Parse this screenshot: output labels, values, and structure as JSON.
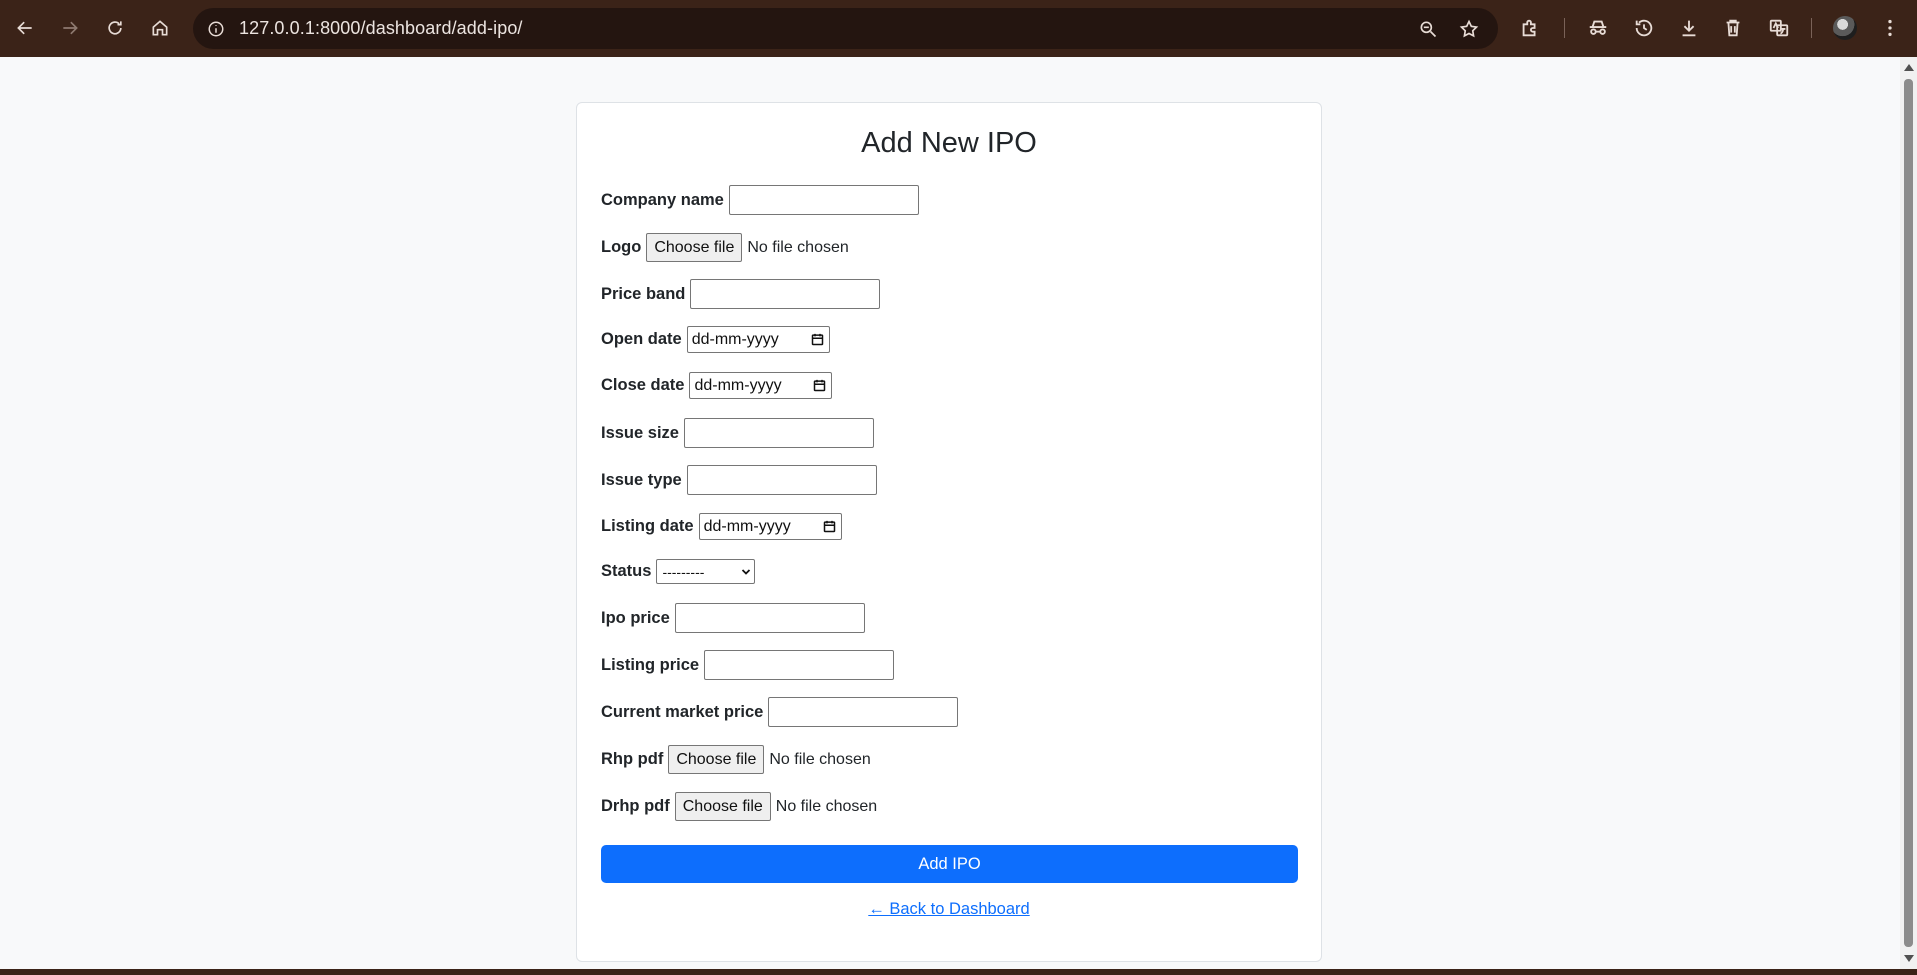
{
  "browser": {
    "url": "127.0.0.1:8000/dashboard/add-ipo/",
    "icons": {
      "back": "back-arrow-icon",
      "forward": "forward-arrow-icon",
      "reload": "reload-icon",
      "home": "home-icon",
      "site_info": "info-icon",
      "zoom": "zoom-icon",
      "bookmark": "star-icon",
      "extensions": "puzzle-icon",
      "incognito": "incognito-icon",
      "history": "history-icon",
      "downloads": "download-icon",
      "delete": "trash-icon",
      "translate": "translate-icon",
      "menu": "kebab-menu-icon"
    }
  },
  "form": {
    "title": "Add New IPO",
    "fields": {
      "company_name": {
        "label": "Company name",
        "value": ""
      },
      "logo": {
        "label": "Logo",
        "button": "Choose file",
        "status": "No file chosen"
      },
      "price_band": {
        "label": "Price band",
        "value": ""
      },
      "open_date": {
        "label": "Open date",
        "placeholder": "dd-mm-yyyy"
      },
      "close_date": {
        "label": "Close date",
        "placeholder": "dd-mm-yyyy"
      },
      "issue_size": {
        "label": "Issue size",
        "value": ""
      },
      "issue_type": {
        "label": "Issue type",
        "value": ""
      },
      "listing_date": {
        "label": "Listing date",
        "placeholder": "dd-mm-yyyy"
      },
      "status": {
        "label": "Status",
        "selected": "---------"
      },
      "ipo_price": {
        "label": "Ipo price",
        "value": ""
      },
      "listing_price": {
        "label": "Listing price",
        "value": ""
      },
      "current_market_price": {
        "label": "Current market price",
        "value": ""
      },
      "rhp_pdf": {
        "label": "Rhp pdf",
        "button": "Choose file",
        "status": "No file chosen"
      },
      "drhp_pdf": {
        "label": "Drhp pdf",
        "button": "Choose file",
        "status": "No file chosen"
      }
    },
    "submit_label": "Add IPO",
    "back_link": "← Back to Dashboard"
  },
  "colors": {
    "chrome_bg": "#3b2318",
    "omnibox_bg": "#241510",
    "primary": "#0d6efd",
    "page_bg": "#f8f9fa"
  }
}
